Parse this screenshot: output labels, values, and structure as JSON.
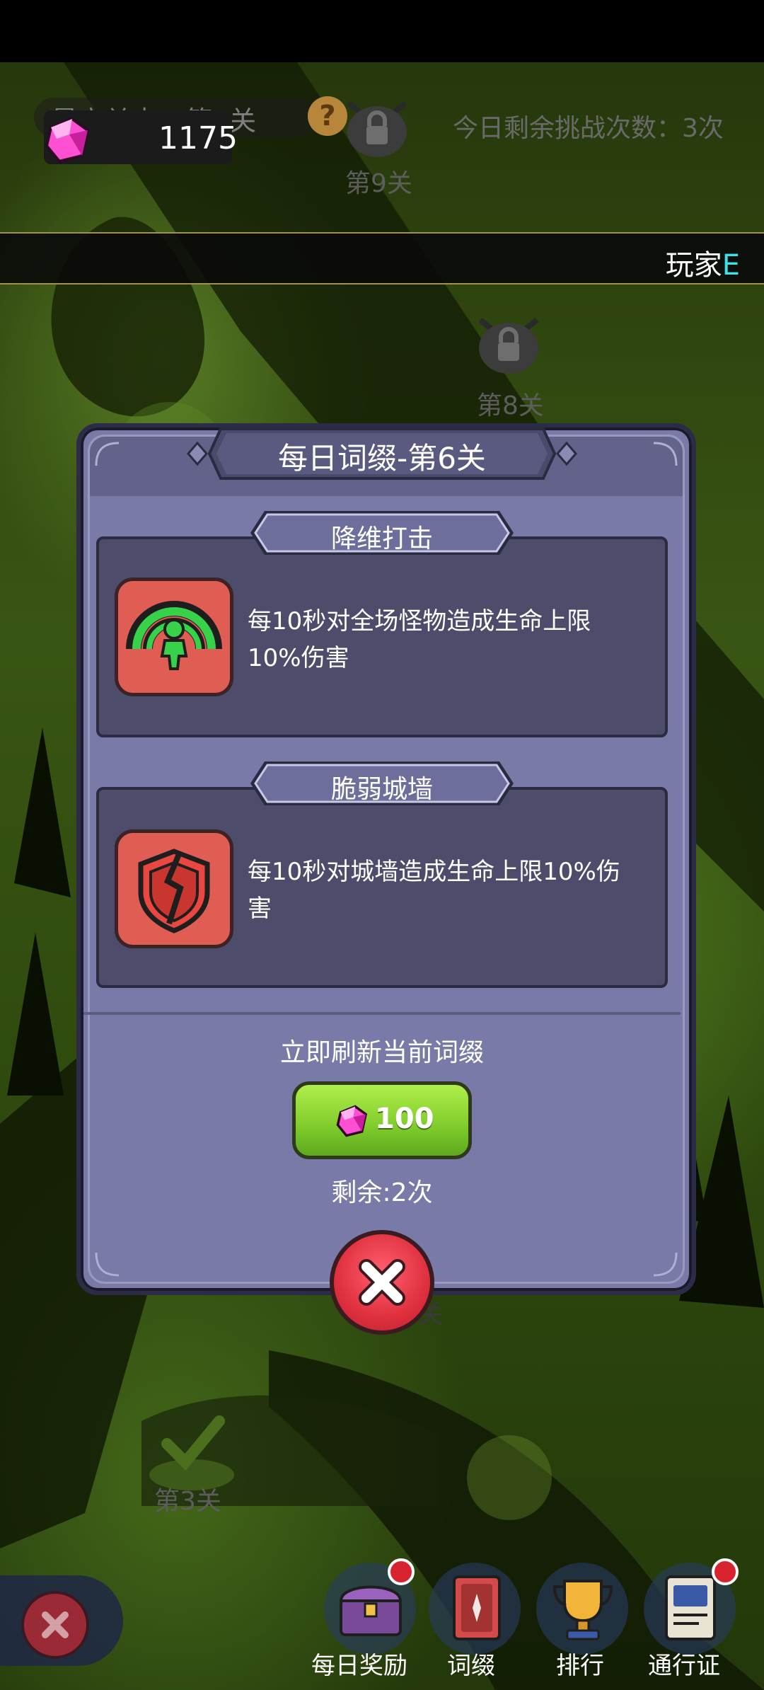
{
  "hud": {
    "best_level": "最高关卡：第5关",
    "gem_count": "1175",
    "tries_left": "今日剩余挑战次数：3次"
  },
  "marquee": {
    "prefix": "玩家",
    "suffix": "E"
  },
  "map": {
    "locked_nodes": [
      "第9关",
      "第8关"
    ],
    "cleared_node": "第3关",
    "partial_label": "关"
  },
  "modal": {
    "title": "每日词缀-第6关",
    "affixes": [
      {
        "name": "降维打击",
        "desc": "每10秒对全场怪物造成生命上限10%伤害",
        "icon": "green-figure-aura-icon"
      },
      {
        "name": "脆弱城墙",
        "desc": "每10秒对城墙造成生命上限10%伤害",
        "icon": "cracked-shield-icon"
      }
    ],
    "refresh_label": "立即刷新当前词缀",
    "refresh_price": "100",
    "remaining": "剩余:2次"
  },
  "bottom_nav": [
    {
      "label": "每日奖励",
      "icon": "treasure-chest-icon",
      "badge": true
    },
    {
      "label": "词缀",
      "icon": "card-icon",
      "badge": false
    },
    {
      "label": "排行",
      "icon": "trophy-icon",
      "badge": false
    },
    {
      "label": "通行证",
      "icon": "passport-icon",
      "badge": true
    }
  ],
  "colors": {
    "accent_green": "#7fcb2c",
    "close_red": "#e0303f",
    "modal_purple": "#7a7aa8"
  }
}
